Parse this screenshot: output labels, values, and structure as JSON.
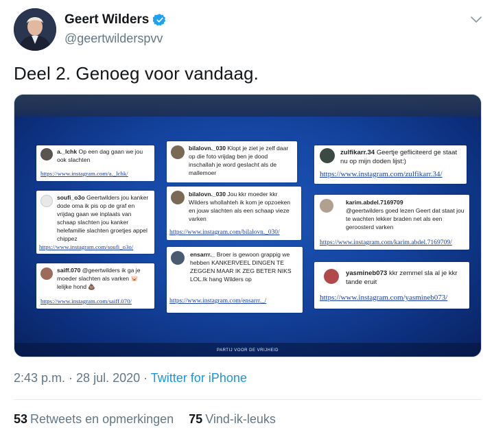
{
  "author": {
    "display_name": "Geert Wilders",
    "handle": "@geertwilderspvv",
    "verified_icon": "verified-badge-icon",
    "accent": "#1da1f2"
  },
  "tweet": {
    "text": "Deel 2. Genoeg voor vandaag."
  },
  "media": {
    "footer_text": "PARTIJ VOOR DE VRIJHEID",
    "cards": [
      {
        "user": "a._lchk",
        "comment": "Op een dag gaan we jou ook slachten",
        "link": "https://www.instagram.com/a._lchk/"
      },
      {
        "user": "soufi_o3o",
        "comment": "Geertwilders jou kanker dode oma ik pis op de graf en vrijdag gaan we inplaats van schaap slachten jou kanker helefamilie slachten groetjes appel chippez",
        "link": "https://www.instagram.com/soufi_o3o/"
      },
      {
        "user": "saiff.070",
        "comment": "@geertwilders ik ga je moeder slachten als varken 🐷 lelijke hond 💩",
        "link": "https://www.instagram.com/saiff.070/"
      },
      {
        "user": "bilalovn._030",
        "comment": "Klopt je ziet je zelf daar op die foto vrijdag ben je dood inschallah je word geslacht als de mallemoer",
        "link": ""
      },
      {
        "user": "bilalovn._030",
        "comment": "Jou kkr moeder kkr Wilders whollahteh ik kom je opzoeken en jouw slachten als een schaap vieze varken",
        "link": "https://www.instagram.com/bilalovn._030/"
      },
      {
        "user": "ensarrr._",
        "comment": "Broer is gewoon grappig we hebben KANKERVEEL DINGEN TE ZEGGEN MAAR IK ZEG BETER NIKS LOL.Ik hang Wilders op",
        "link": "https://www.instagram.com/ensarrr._/"
      },
      {
        "user": "zulfikarr.34",
        "comment": "Geertje gefliciteerd ge staat nu op mijn doden lijst:)",
        "link": "https://www.instagram.com/zulfikarr.34/"
      },
      {
        "user": "karim.abdel.7169709",
        "comment": "@geertwilders goed lezen Geert dat staat jou te wachten lekker braden net als een geroosterd varken",
        "link": "https://www.instagram.com/karim.abdel.7169709/"
      },
      {
        "user": "yasmineb073",
        "comment": "kkr zemmel sla al je kkr tande eruit",
        "link": "https://www.instagram.com/yasmineb073/"
      }
    ]
  },
  "meta": {
    "time": "2:43 p.m.",
    "separator": " · ",
    "date": "28 jul. 2020",
    "separator2": " · ",
    "source": "Twitter for iPhone"
  },
  "stats": {
    "retweets_count": "53",
    "retweets_label": "Retweets en opmerkingen",
    "likes_count": "75",
    "likes_label": "Vind-ik-leuks"
  }
}
